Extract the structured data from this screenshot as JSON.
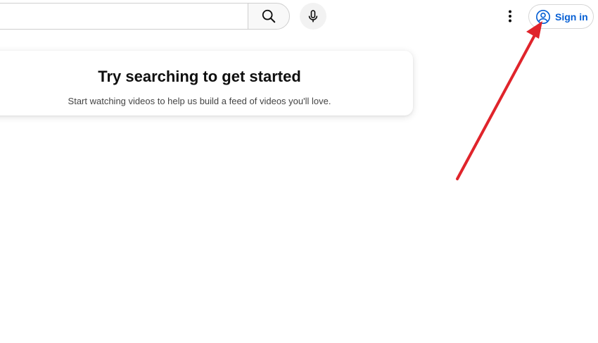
{
  "header": {
    "search": {
      "value": "",
      "placeholder": ""
    },
    "search_icon": "search-icon",
    "mic_icon": "mic-icon",
    "more_icon": "more-vertical-icon",
    "sign_in_label": "Sign in",
    "accent": "#065fd4"
  },
  "empty_state": {
    "title": "Try searching to get started",
    "subtitle": "Start watching videos to help us build a feed of videos you'll love."
  },
  "annotation": {
    "arrow_color": "#e0242b"
  }
}
